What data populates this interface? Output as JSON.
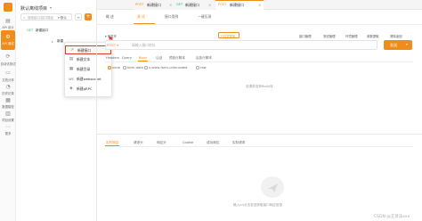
{
  "sidebar": {
    "project_name": "默认离线项目",
    "search_placeholder": "搜索接口/接口路径",
    "sort_label": "▾ 默认",
    "items": [
      {
        "icon": "document-icon",
        "label": "API 设计"
      },
      {
        "icon": "gear-icon",
        "label": "API 调试"
      },
      {
        "icon": "share-icon",
        "label": "自动化测试"
      },
      {
        "icon": "doc-share-icon",
        "label": "文档分享"
      },
      {
        "icon": "clock-icon",
        "label": "历史记录"
      },
      {
        "icon": "database-icon",
        "label": "数据模型"
      },
      {
        "icon": "project-settings-icon",
        "label": "项目设置"
      },
      {
        "icon": "more-icon",
        "label": "更多"
      }
    ],
    "tree": [
      {
        "method": "GET",
        "name": "新建接口"
      },
      {
        "name": "新建"
      }
    ]
  },
  "context_menu": {
    "items": [
      {
        "icon": "api-icon",
        "label": "新建接口"
      },
      {
        "icon": "document-icon",
        "label": "新建文本"
      },
      {
        "icon": "database-icon",
        "label": "新建目录"
      },
      {
        "icon": "ws-icon",
        "label": "新建websocket"
      },
      {
        "icon": "grpc-icon",
        "label": "新建gRPC"
      }
    ]
  },
  "tabs": [
    {
      "method": "POST",
      "name": "新建接口"
    },
    {
      "method": "GET",
      "name": "新建接口"
    },
    {
      "method": "POST",
      "name": "新建接口"
    }
  ],
  "mode_tabs": [
    "概 述",
    "测 试",
    "接口用例",
    "一键压测"
  ],
  "request": {
    "env": "▾ 开发环",
    "mock_label": "已应答预测",
    "header_buttons": [
      "接口管理",
      "测试管理",
      "环境管理",
      "参数提取",
      "清除返回"
    ],
    "method": "POST",
    "url_placeholder": "请输入接口地址",
    "send_label": "发送",
    "sub_tabs": [
      "Headers",
      "Query",
      "Body",
      "认证",
      "预执行脚本",
      "后执行脚本"
    ],
    "body_types": [
      "none",
      "form-data",
      "x-www-form-urlencoded",
      "raw"
    ],
    "empty_text": "该请求没有Body体"
  },
  "response": {
    "tabs": [
      "实时响应",
      "请求头",
      "响应头",
      "Cookie",
      "成功响应",
      "实际请求"
    ],
    "empty_text": "输入url点击发送获取接口响应信息"
  },
  "watermark": "CSDN @王贤法xxx",
  "colors": {
    "accent": "#f08c1a",
    "get": "#2bb673"
  }
}
